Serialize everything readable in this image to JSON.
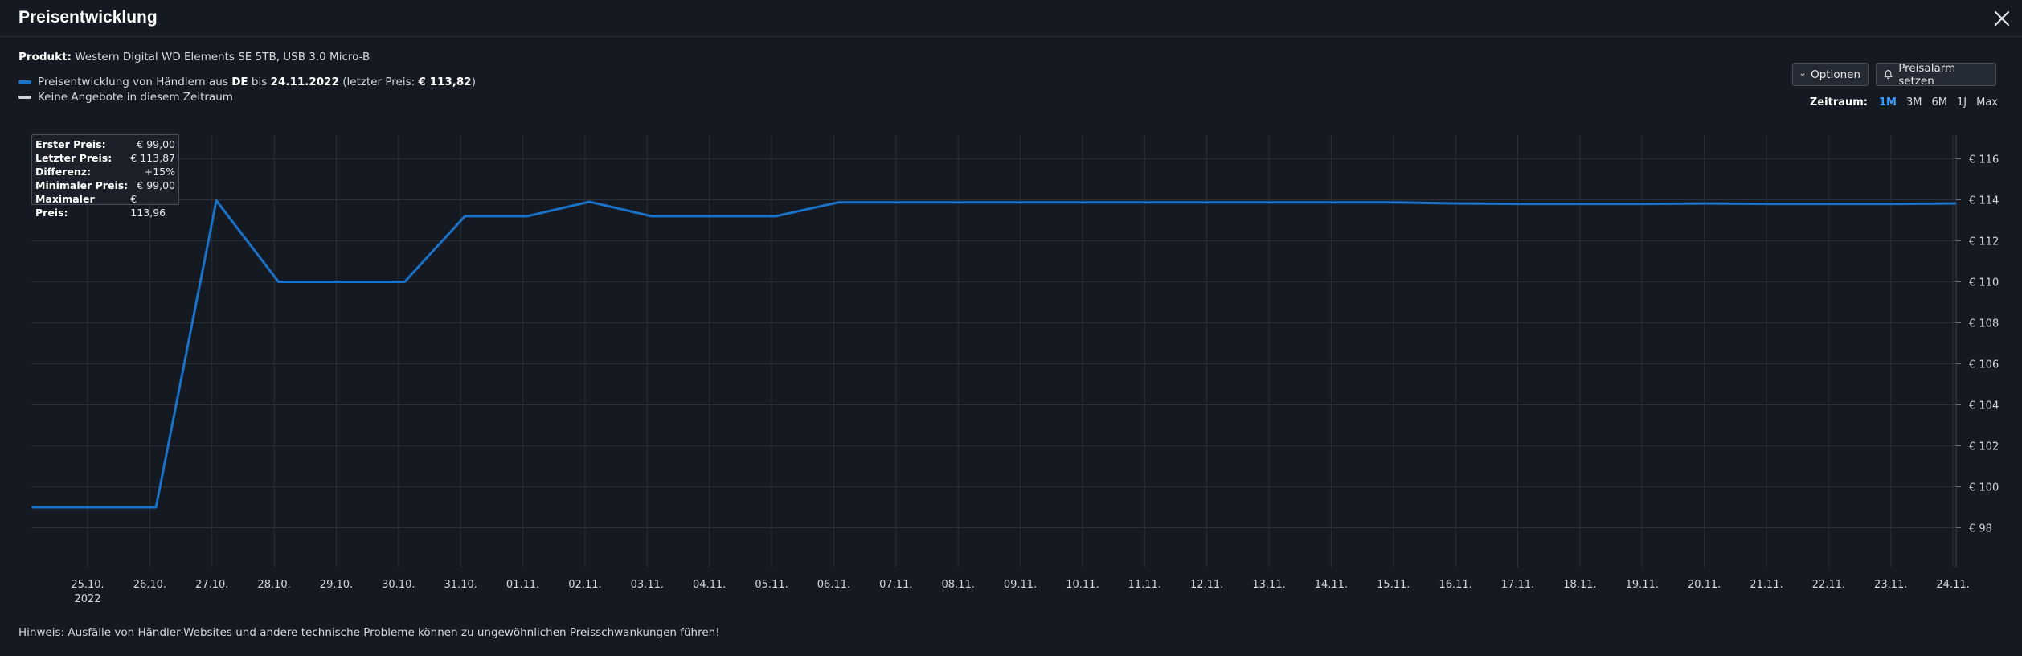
{
  "dialog": {
    "title": "Preisentwicklung"
  },
  "product": {
    "label": "Produkt:",
    "name": "Western Digital WD Elements SE 5TB, USB 3.0 Micro-B"
  },
  "legend": {
    "line_color": "#1a73c9",
    "none_color": "#cfd3d8",
    "entry1_pre": "Preisentwicklung von Händlern aus ",
    "entry1_country": "DE",
    "entry1_mid": " bis ",
    "entry1_date": "24.11.2022",
    "entry1_last_pre": " (letzter Preis: ",
    "entry1_last_price": "€ 113,82",
    "entry1_close": ")",
    "entry2": "Keine Angebote in diesem Zeitraum"
  },
  "toolbar": {
    "options_label": "Optionen",
    "alarm_label": "Preisalarm setzen",
    "range_label": "Zeitraum:",
    "range_options": [
      "1M",
      "3M",
      "6M",
      "1J",
      "Max"
    ],
    "range_active": "1M"
  },
  "summary": {
    "rows": [
      {
        "k": "Erster Preis:",
        "v": "€ 99,00"
      },
      {
        "k": "Letzter Preis:",
        "v": "€ 113,87"
      },
      {
        "k": "Differenz:",
        "v": "+15%"
      },
      {
        "k": "Minimaler Preis:",
        "v": "€ 99,00"
      },
      {
        "k": "Maximaler Preis:",
        "v": "€ 113,96"
      }
    ]
  },
  "footer": {
    "note": "Hinweis: Ausfälle von Händler-Websites und andere technische Probleme können zu ungewöhnlichen Preisschwankungen führen!"
  },
  "chart_data": {
    "type": "line",
    "x_tick_labels": [
      "25.10.",
      "26.10.",
      "27.10.",
      "28.10.",
      "29.10.",
      "30.10.",
      "31.10.",
      "01.11.",
      "02.11.",
      "03.11.",
      "04.11.",
      "05.11.",
      "06.11.",
      "07.11.",
      "08.11.",
      "09.11.",
      "10.11.",
      "11.11.",
      "12.11.",
      "13.11.",
      "14.11.",
      "15.11.",
      "16.11.",
      "17.11.",
      "18.11.",
      "19.11.",
      "20.11.",
      "21.11.",
      "22.11.",
      "23.11.",
      "24.11."
    ],
    "x_year_label": "2022",
    "y_ticks": [
      98,
      100,
      102,
      104,
      106,
      108,
      110,
      112,
      114,
      116
    ],
    "y_tick_labels": [
      "€ 98",
      "€ 100",
      "€ 102",
      "€ 104",
      "€ 106",
      "€ 108",
      "€ 110",
      "€ 112",
      "€ 114",
      "€ 116"
    ],
    "ylim": [
      96,
      117.8
    ],
    "xlim": [
      -0.9,
      30.05
    ],
    "y_axis_position": "right",
    "grid": true,
    "series": [
      {
        "color": "#1a73c9",
        "points": [
          [
            -0.9,
            99.0
          ],
          [
            1.1,
            99.0
          ],
          [
            2.07,
            113.96
          ],
          [
            3.07,
            110.0
          ],
          [
            4.1,
            110.0
          ],
          [
            5.1,
            110.0
          ],
          [
            6.07,
            113.2
          ],
          [
            7.07,
            113.2
          ],
          [
            8.07,
            113.9
          ],
          [
            9.07,
            113.2
          ],
          [
            10.07,
            113.2
          ],
          [
            11.07,
            113.2
          ],
          [
            12.07,
            113.87
          ],
          [
            13.07,
            113.87
          ],
          [
            14.07,
            113.87
          ],
          [
            15.07,
            113.87
          ],
          [
            16.07,
            113.87
          ],
          [
            17.07,
            113.87
          ],
          [
            18.07,
            113.87
          ],
          [
            19.07,
            113.87
          ],
          [
            20.07,
            113.87
          ],
          [
            21.07,
            113.87
          ],
          [
            22.07,
            113.82
          ],
          [
            23.07,
            113.8
          ],
          [
            24.07,
            113.8
          ],
          [
            25.07,
            113.8
          ],
          [
            26.07,
            113.82
          ],
          [
            27.07,
            113.8
          ],
          [
            28.07,
            113.8
          ],
          [
            29.07,
            113.8
          ],
          [
            30.05,
            113.82
          ]
        ]
      }
    ]
  }
}
